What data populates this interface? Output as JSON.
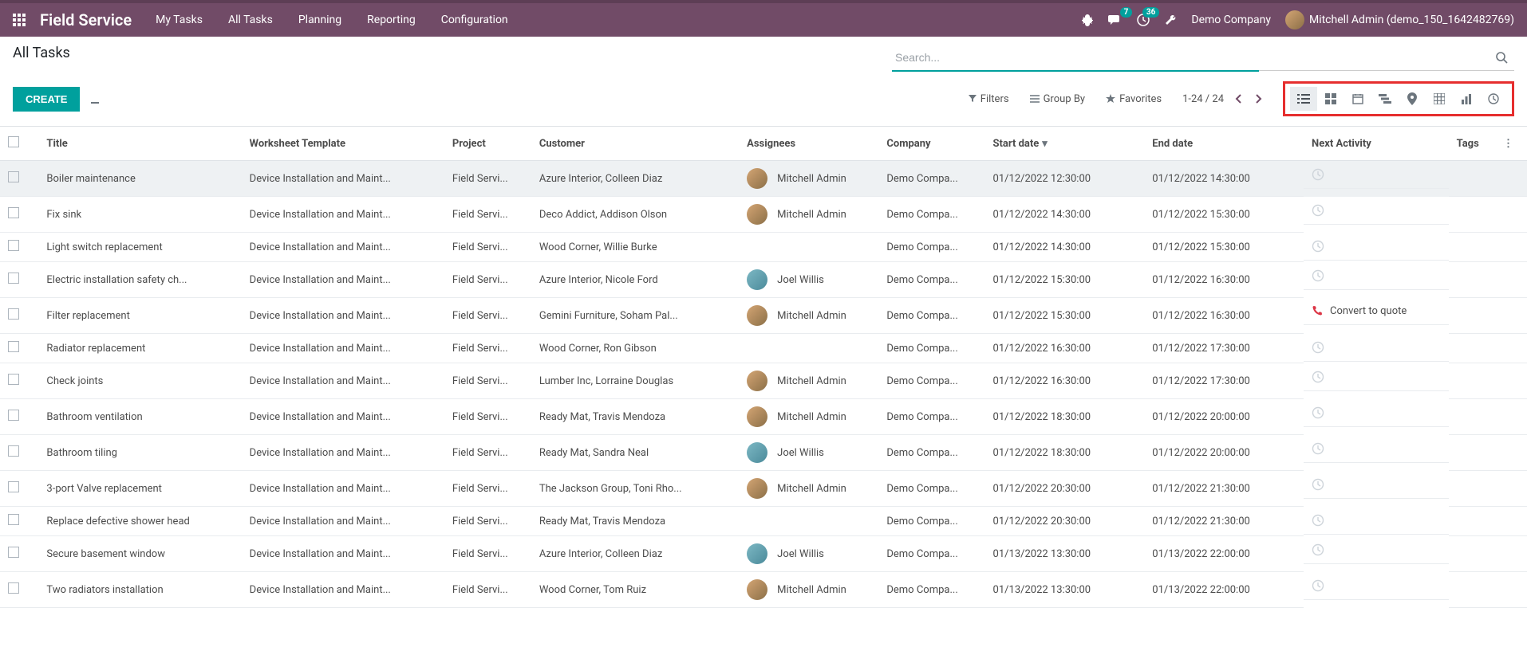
{
  "nav": {
    "brand": "Field Service",
    "menu": [
      "My Tasks",
      "All Tasks",
      "Planning",
      "Reporting",
      "Configuration"
    ],
    "msg_badge": "7",
    "act_badge": "36",
    "company": "Demo Company",
    "user": "Mitchell Admin (demo_150_1642482769)"
  },
  "cp": {
    "title": "All Tasks",
    "search_placeholder": "Search...",
    "create": "CREATE",
    "filters": "Filters",
    "groupby": "Group By",
    "favorites": "Favorites",
    "pager": "1-24 / 24"
  },
  "cols": {
    "title": "Title",
    "worksheet": "Worksheet Template",
    "project": "Project",
    "customer": "Customer",
    "assignees": "Assignees",
    "company": "Company",
    "start": "Start date",
    "end": "End date",
    "next": "Next Activity",
    "tags": "Tags"
  },
  "rows": [
    {
      "title": "Boiler maintenance",
      "worksheet": "Device Installation and Maint...",
      "project": "Field Servi...",
      "customer": "Azure Interior, Colleen Diaz",
      "assignee": "Mitchell Admin",
      "atype": "m",
      "company": "Demo Compa...",
      "start": "01/12/2022 12:30:00",
      "end": "01/12/2022 14:30:00",
      "activity": ""
    },
    {
      "title": "Fix sink",
      "worksheet": "Device Installation and Maint...",
      "project": "Field Servi...",
      "customer": "Deco Addict, Addison Olson",
      "assignee": "Mitchell Admin",
      "atype": "m",
      "company": "Demo Compa...",
      "start": "01/12/2022 14:30:00",
      "end": "01/12/2022 15:30:00",
      "activity": ""
    },
    {
      "title": "Light switch replacement",
      "worksheet": "Device Installation and Maint...",
      "project": "Field Servi...",
      "customer": "Wood Corner, Willie Burke",
      "assignee": "",
      "atype": "",
      "company": "Demo Compa...",
      "start": "01/12/2022 14:30:00",
      "end": "01/12/2022 15:30:00",
      "activity": ""
    },
    {
      "title": "Electric installation safety ch...",
      "worksheet": "Device Installation and Maint...",
      "project": "Field Servi...",
      "customer": "Azure Interior, Nicole Ford",
      "assignee": "Joel Willis",
      "atype": "j",
      "company": "Demo Compa...",
      "start": "01/12/2022 15:30:00",
      "end": "01/12/2022 16:30:00",
      "activity": ""
    },
    {
      "title": "Filter replacement",
      "worksheet": "Device Installation and Maint...",
      "project": "Field Servi...",
      "customer": "Gemini Furniture, Soham Pal...",
      "assignee": "Mitchell Admin",
      "atype": "m",
      "company": "Demo Compa...",
      "start": "01/12/2022 15:30:00",
      "end": "01/12/2022 16:30:00",
      "activity": "Convert to quote"
    },
    {
      "title": "Radiator replacement",
      "worksheet": "Device Installation and Maint...",
      "project": "Field Servi...",
      "customer": "Wood Corner, Ron Gibson",
      "assignee": "",
      "atype": "",
      "company": "Demo Compa...",
      "start": "01/12/2022 16:30:00",
      "end": "01/12/2022 17:30:00",
      "activity": ""
    },
    {
      "title": "Check joints",
      "worksheet": "Device Installation and Maint...",
      "project": "Field Servi...",
      "customer": "Lumber Inc, Lorraine Douglas",
      "assignee": "Mitchell Admin",
      "atype": "m",
      "company": "Demo Compa...",
      "start": "01/12/2022 16:30:00",
      "end": "01/12/2022 17:30:00",
      "activity": ""
    },
    {
      "title": "Bathroom ventilation",
      "worksheet": "Device Installation and Maint...",
      "project": "Field Servi...",
      "customer": "Ready Mat, Travis Mendoza",
      "assignee": "Mitchell Admin",
      "atype": "m",
      "company": "Demo Compa...",
      "start": "01/12/2022 18:30:00",
      "end": "01/12/2022 20:00:00",
      "activity": ""
    },
    {
      "title": "Bathroom tiling",
      "worksheet": "Device Installation and Maint...",
      "project": "Field Servi...",
      "customer": "Ready Mat, Sandra Neal",
      "assignee": "Joel Willis",
      "atype": "j",
      "company": "Demo Compa...",
      "start": "01/12/2022 18:30:00",
      "end": "01/12/2022 20:00:00",
      "activity": ""
    },
    {
      "title": "3-port Valve replacement",
      "worksheet": "Device Installation and Maint...",
      "project": "Field Servi...",
      "customer": "The Jackson Group, Toni Rho...",
      "assignee": "Mitchell Admin",
      "atype": "m",
      "company": "Demo Compa...",
      "start": "01/12/2022 20:30:00",
      "end": "01/12/2022 21:30:00",
      "activity": ""
    },
    {
      "title": "Replace defective shower head",
      "worksheet": "Device Installation and Maint...",
      "project": "Field Servi...",
      "customer": "Ready Mat, Travis Mendoza",
      "assignee": "",
      "atype": "",
      "company": "Demo Compa...",
      "start": "01/12/2022 20:30:00",
      "end": "01/12/2022 21:30:00",
      "activity": ""
    },
    {
      "title": "Secure basement window",
      "worksheet": "Device Installation and Maint...",
      "project": "Field Servi...",
      "customer": "Azure Interior, Colleen Diaz",
      "assignee": "Joel Willis",
      "atype": "j",
      "company": "Demo Compa...",
      "start": "01/13/2022 13:30:00",
      "end": "01/13/2022 22:00:00",
      "activity": ""
    },
    {
      "title": "Two radiators installation",
      "worksheet": "Device Installation and Maint...",
      "project": "Field Servi...",
      "customer": "Wood Corner, Tom Ruiz",
      "assignee": "Mitchell Admin",
      "atype": "m",
      "company": "Demo Compa...",
      "start": "01/13/2022 13:30:00",
      "end": "01/13/2022 22:00:00",
      "activity": ""
    }
  ]
}
